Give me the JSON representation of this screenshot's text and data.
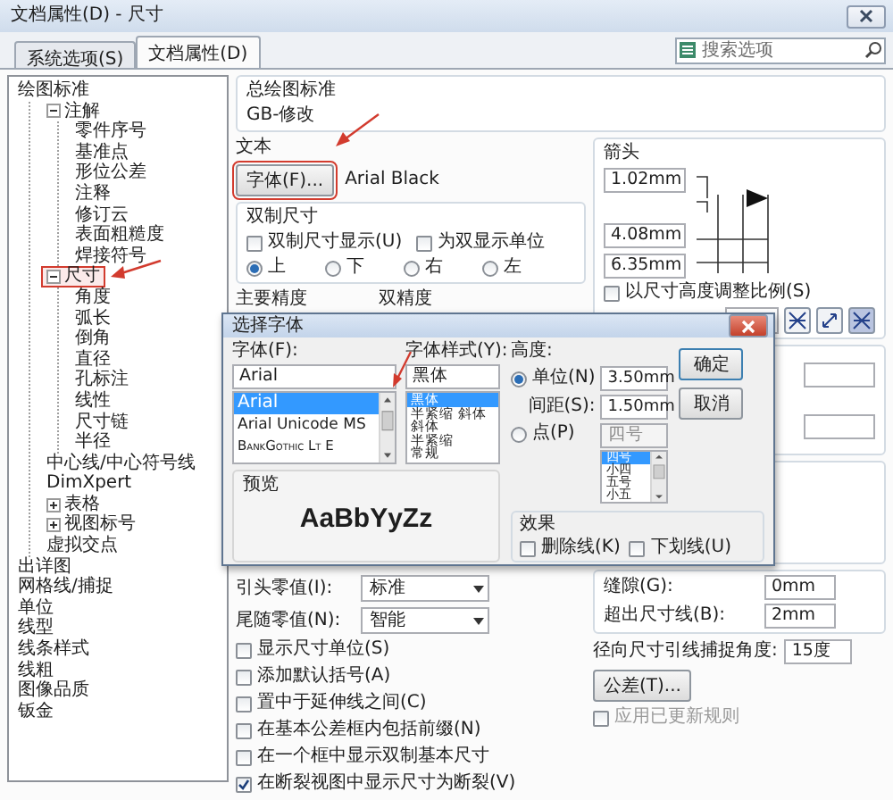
{
  "window": {
    "title": "文档属性(D) - 尺寸"
  },
  "tabs": [
    {
      "label": "系统选项(S)",
      "selected": false
    },
    {
      "label": "文档属性(D)",
      "selected": true
    }
  ],
  "search": {
    "placeholder": "搜索选项"
  },
  "tree": [
    {
      "label": "绘图标准",
      "selected": false,
      "children": [
        {
          "label": "注解",
          "expanded": true,
          "selected": false,
          "children": [
            {
              "label": "零件序号",
              "selected": false
            },
            {
              "label": "基准点",
              "selected": false
            },
            {
              "label": "形位公差",
              "selected": false
            },
            {
              "label": "注释",
              "selected": false
            },
            {
              "label": "修订云",
              "selected": false
            },
            {
              "label": "表面粗糙度",
              "selected": false
            },
            {
              "label": "焊接符号",
              "selected": false
            }
          ]
        },
        {
          "label": "尺寸",
          "expanded": true,
          "selected": true,
          "children": [
            {
              "label": "角度",
              "selected": false
            },
            {
              "label": "弧长",
              "selected": false
            },
            {
              "label": "倒角",
              "selected": false
            },
            {
              "label": "直径",
              "selected": false
            },
            {
              "label": "孔标注",
              "selected": false
            },
            {
              "label": "线性",
              "selected": false
            },
            {
              "label": "尺寸链",
              "selected": false
            },
            {
              "label": "半径",
              "selected": false
            }
          ]
        },
        {
          "label": "中心线/中心符号线",
          "selected": false
        },
        {
          "label": "DimXpert",
          "selected": false
        },
        {
          "label": "表格",
          "expanded": false,
          "selected": false
        },
        {
          "label": "视图标号",
          "expanded": false,
          "selected": false
        },
        {
          "label": "虚拟交点",
          "selected": false
        }
      ]
    },
    {
      "label": "出详图",
      "selected": false
    },
    {
      "label": "网格线/捕捉",
      "selected": false
    },
    {
      "label": "单位",
      "selected": false
    },
    {
      "label": "线型",
      "selected": false
    },
    {
      "label": "线条样式",
      "selected": false
    },
    {
      "label": "线粗",
      "selected": false
    },
    {
      "label": "图像品质",
      "selected": false
    },
    {
      "label": "钣金",
      "selected": false
    }
  ],
  "drafting_standard": {
    "label": "总绘图标准",
    "value": "GB-修改"
  },
  "text": {
    "label": "文本",
    "font_button": "字体(F)...",
    "font_name": "Arial Black"
  },
  "dual": {
    "label": "双制尺寸",
    "checkboxes": [
      {
        "label": "双制尺寸显示(U)",
        "checked": false
      },
      {
        "label": "为双显示单位",
        "checked": false
      }
    ],
    "radios": [
      {
        "label": "上",
        "selected": true
      },
      {
        "label": "下",
        "selected": false
      },
      {
        "label": "右",
        "selected": false
      },
      {
        "label": "左",
        "selected": false
      }
    ]
  },
  "precision_labels": [
    "主要精度",
    "双精度"
  ],
  "arrows": {
    "label": "箭头",
    "sizes": [
      "1.02mm",
      "4.08mm",
      "6.35mm"
    ],
    "scale_checkbox": {
      "label": "以尺寸高度调整比例(S)",
      "checked": false
    },
    "style_buttons": [
      {
        "kind": "cross",
        "selected": false
      },
      {
        "kind": "slant",
        "selected": false
      },
      {
        "kind": "cross",
        "selected": true
      }
    ]
  },
  "zeros": [
    {
      "label": "引头零值(I):",
      "value": "标准"
    },
    {
      "label": "尾随零值(N):",
      "value": "智能"
    }
  ],
  "options": [
    {
      "label": "显示尺寸单位(S)",
      "checked": false
    },
    {
      "label": "添加默认括号(A)",
      "checked": false
    },
    {
      "label": "置中于延伸线之间(C)",
      "checked": false
    },
    {
      "label": "在基本公差框内包括前缀(N)",
      "checked": false
    },
    {
      "label": "在一个框中显示双制基本尺寸",
      "checked": false
    },
    {
      "label": "在断裂视图中显示尺寸为断裂(V)",
      "checked": true
    }
  ],
  "offsets": [
    {
      "label": "缝隙(G):",
      "value": "0mm"
    },
    {
      "label": "超出尺寸线(B):",
      "value": "2mm"
    }
  ],
  "radial": {
    "label": "径向尺寸引线捕捉角度:",
    "value": "15度"
  },
  "tolerance_button": "公差(T)...",
  "apply_rule": {
    "label": "应用已更新规则",
    "checked": false,
    "disabled": true
  },
  "font_dialog": {
    "title": "选择字体",
    "font": {
      "label": "字体(F):",
      "value": "Arial",
      "items": [
        {
          "label": "Arial",
          "selected": true
        },
        {
          "label": "Arial Unicode MS",
          "selected": false
        },
        {
          "label": "BankGothic Lt E",
          "selected": false
        }
      ]
    },
    "style": {
      "label": "字体样式(Y):",
      "value": "黑体",
      "items": [
        {
          "label": "黑体",
          "selected": true
        },
        {
          "label": "半紧缩 斜体",
          "selected": false
        },
        {
          "label": "斜体",
          "selected": false
        },
        {
          "label": "半紧缩",
          "selected": false
        },
        {
          "label": "常规",
          "selected": false
        }
      ]
    },
    "preview": {
      "label": "预览",
      "sample": "AaBbYyZz"
    },
    "height": {
      "label": "高度:",
      "unit": {
        "label": "单位(N)",
        "selected": true,
        "value": "3.50mm"
      },
      "spacing": {
        "label": "间距(S):",
        "value": "1.50mm"
      },
      "points": {
        "label": "点(P)",
        "selected": false,
        "value": "四号",
        "items": [
          {
            "label": "四号",
            "selected": true
          },
          {
            "label": "小四",
            "selected": false
          },
          {
            "label": "五号",
            "selected": false
          },
          {
            "label": "小五",
            "selected": false
          }
        ]
      }
    },
    "buttons": [
      "确定",
      "取消"
    ],
    "effects": {
      "label": "效果",
      "checkboxes": [
        {
          "label": "删除线(K)",
          "checked": false
        },
        {
          "label": "下划线(U)",
          "checked": false
        }
      ]
    }
  }
}
